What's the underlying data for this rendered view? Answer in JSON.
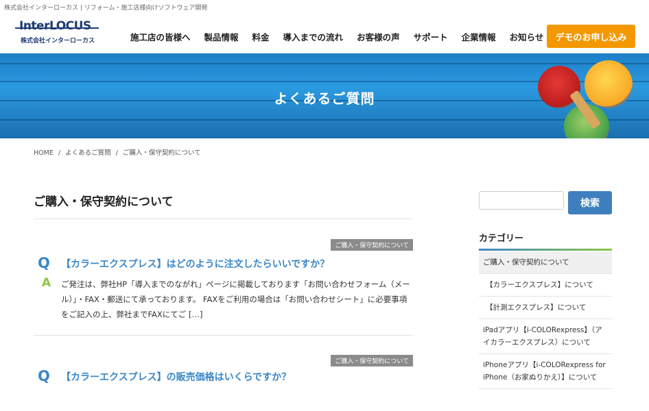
{
  "header": {
    "tagline": "株式会社インターローカス | リフォーム・施工店様向けソフトウェア開発",
    "logo_main": "InterLOCUS",
    "logo_sub": "株式会社インターローカス",
    "nav": [
      "施工店の皆様へ",
      "製品情報",
      "料金",
      "導入までの流れ",
      "お客様の声",
      "サポート",
      "企業情報",
      "お知らせ"
    ],
    "demo_button": "デモのお申し込み"
  },
  "hero": {
    "title": "よくあるご質問"
  },
  "breadcrumb": [
    "HOME",
    "/",
    "よくあるご質問",
    "/",
    "ご購入・保守契約について"
  ],
  "main": {
    "page_title": "ご購入・保守契約について",
    "faqs": [
      {
        "category": "ご購入・保守契約について",
        "q_mark": "Q",
        "question": "【カラーエクスプレス】はどのように注文したらいいですか？",
        "a_mark": "A",
        "answer": "ご発注は、弊社HP「導入までのながれ」ページに掲載しております「お問い合わせフォーム（メール）」・FAX・郵送にて承っております。 FAXをご利用の場合は「お問い合わせシート」に必要事項をご記入の上、弊社までFAXにてご […]"
      },
      {
        "category": "ご購入・保守契約について",
        "q_mark": "Q",
        "question": "【カラーエクスプレス】の販売価格はいくらですか？",
        "a_mark": "",
        "answer": ""
      }
    ]
  },
  "sidebar": {
    "search_placeholder": "",
    "search_button": "検索",
    "category_heading": "カテゴリー",
    "categories": [
      "ご購入・保守契約について",
      "【カラーエクスプレス】について",
      "【計測エクスプレス】について",
      "iPadアプリ【i-COLORexpress】（アイカラーエクスプレス）について",
      "iPhoneアプリ【i-COLORexpress for iPhone（お家ぬりかえ）】について"
    ]
  },
  "colors": {
    "accent_blue": "#3a87c8",
    "accent_green": "#8cc63f",
    "demo_orange": "#f39800",
    "logo_navy": "#1d3b73"
  }
}
